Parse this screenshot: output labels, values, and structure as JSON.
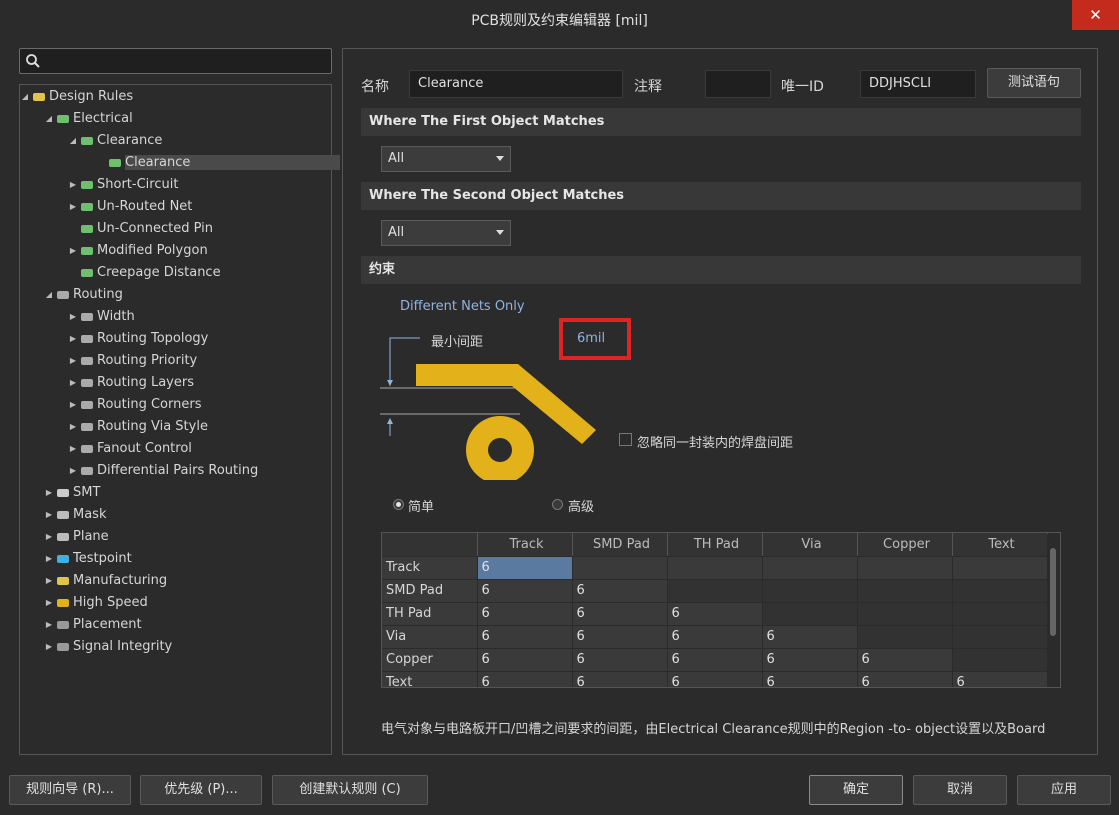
{
  "window": {
    "title": "PCB规则及约束编辑器 [mil]",
    "close_glyph": "✕"
  },
  "search": {
    "placeholder": ""
  },
  "tree": [
    {
      "label": "Design Rules",
      "arrow": "◢",
      "icon": "rules-folder-icon"
    },
    {
      "label": "Electrical",
      "arrow": "◢",
      "icon": "electrical-icon"
    },
    {
      "label": "Clearance",
      "arrow": "◢",
      "icon": "clearance-icon"
    },
    {
      "label": "Clearance",
      "arrow": "",
      "icon": "clearance-icon"
    },
    {
      "label": "Short-Circuit",
      "arrow": "▶",
      "icon": "short-circuit-icon"
    },
    {
      "label": "Un-Routed Net",
      "arrow": "▶",
      "icon": "unrouted-net-icon"
    },
    {
      "label": "Un-Connected Pin",
      "arrow": "",
      "icon": "unconnected-pin-icon"
    },
    {
      "label": "Modified Polygon",
      "arrow": "▶",
      "icon": "modified-polygon-icon"
    },
    {
      "label": "Creepage Distance",
      "arrow": "",
      "icon": "creepage-icon"
    },
    {
      "label": "Routing",
      "arrow": "◢",
      "icon": "routing-icon"
    },
    {
      "label": "Width",
      "arrow": "▶",
      "icon": "routing-icon"
    },
    {
      "label": "Routing Topology",
      "arrow": "▶",
      "icon": "routing-icon"
    },
    {
      "label": "Routing Priority",
      "arrow": "▶",
      "icon": "routing-icon"
    },
    {
      "label": "Routing Layers",
      "arrow": "▶",
      "icon": "routing-icon"
    },
    {
      "label": "Routing Corners",
      "arrow": "▶",
      "icon": "routing-icon"
    },
    {
      "label": "Routing Via Style",
      "arrow": "▶",
      "icon": "routing-icon"
    },
    {
      "label": "Fanout Control",
      "arrow": "▶",
      "icon": "routing-icon"
    },
    {
      "label": "Differential Pairs Routing",
      "arrow": "▶",
      "icon": "routing-icon"
    },
    {
      "label": "SMT",
      "arrow": "▶",
      "icon": "smt-icon"
    },
    {
      "label": "Mask",
      "arrow": "▶",
      "icon": "mask-icon"
    },
    {
      "label": "Plane",
      "arrow": "▶",
      "icon": "plane-icon"
    },
    {
      "label": "Testpoint",
      "arrow": "▶",
      "icon": "testpoint-icon"
    },
    {
      "label": "Manufacturing",
      "arrow": "▶",
      "icon": "manufacturing-icon"
    },
    {
      "label": "High Speed",
      "arrow": "▶",
      "icon": "high-speed-icon"
    },
    {
      "label": "Placement",
      "arrow": "▶",
      "icon": "placement-icon"
    },
    {
      "label": "Signal Integrity",
      "arrow": "▶",
      "icon": "signal-integrity-icon"
    }
  ],
  "rule": {
    "name_label": "名称",
    "name_value": "Clearance",
    "comment_label": "注释",
    "comment_value": "",
    "uid_label": "唯一ID",
    "uid_value": "DDJHSCLI",
    "test_button": "测试语句"
  },
  "first_match": {
    "header": "Where The First Object Matches",
    "selected": "All"
  },
  "second_match": {
    "header": "Where The Second Object Matches",
    "selected": "All"
  },
  "constraints": {
    "header": "约束",
    "net_scope": "Different Nets Only",
    "min_clearance_label": "最小间距",
    "min_clearance_value": "6mil",
    "ignore_pads_label": "忽略同一封装内的焊盘间距",
    "ignore_pads_checked": false,
    "mode_simple": "简单",
    "mode_advanced": "高级",
    "mode_selected": "simple"
  },
  "grid": {
    "columns": [
      "Track",
      "SMD Pad",
      "TH Pad",
      "Via",
      "Copper",
      "Text"
    ],
    "rows": [
      {
        "label": "Track",
        "values": [
          "6",
          "",
          "",
          "",
          "",
          ""
        ]
      },
      {
        "label": "SMD Pad",
        "values": [
          "6",
          "6"
        ]
      },
      {
        "label": "TH Pad",
        "values": [
          "6",
          "6",
          "6"
        ]
      },
      {
        "label": "Via",
        "values": [
          "6",
          "6",
          "6",
          "6"
        ]
      },
      {
        "label": "Copper",
        "values": [
          "6",
          "6",
          "6",
          "6",
          "6"
        ]
      },
      {
        "label": "Text",
        "values": [
          "6",
          "6",
          "6",
          "6",
          "6",
          "6"
        ]
      }
    ]
  },
  "description": "电气对象与电路板开口/凹槽之间要求的间距，由Electrical Clearance规则中的Region -to- object设置以及Board",
  "footer": {
    "rule_wizard": "规则向导 (R)...",
    "priorities": "优先级 (P)...",
    "create_default": "创建默认规则 (C)",
    "ok": "确定",
    "cancel": "取消",
    "apply": "应用"
  },
  "colors": {
    "accent_gold": "#e3b21a",
    "highlight_red": "#e02424",
    "link_blue": "#8fb4e0"
  }
}
